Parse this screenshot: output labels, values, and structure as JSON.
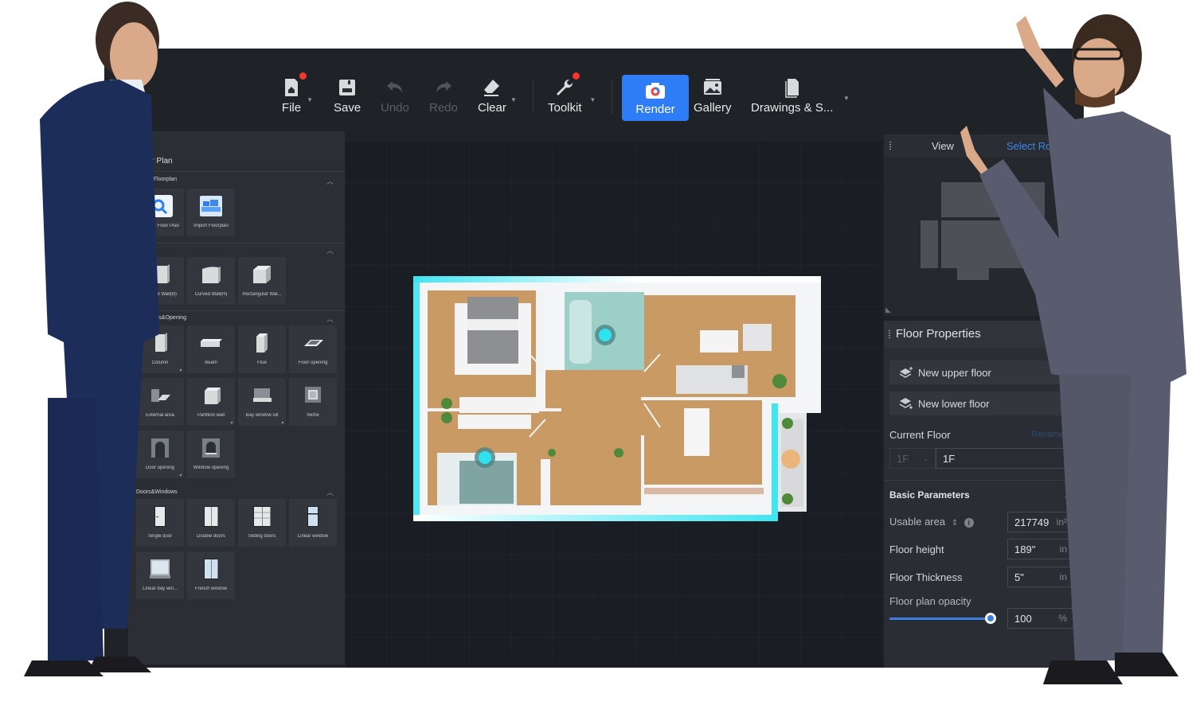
{
  "toolbar": {
    "items": [
      {
        "label": "File",
        "icon": "file-home-icon",
        "has_dropdown": true,
        "badge": true,
        "enabled": true
      },
      {
        "label": "Save",
        "icon": "save-icon",
        "has_dropdown": false,
        "badge": false,
        "enabled": true
      },
      {
        "label": "Undo",
        "icon": "undo-icon",
        "has_dropdown": false,
        "badge": false,
        "enabled": false
      },
      {
        "label": "Redo",
        "icon": "redo-icon",
        "has_dropdown": false,
        "badge": false,
        "enabled": false
      },
      {
        "label": "Clear",
        "icon": "eraser-icon",
        "has_dropdown": true,
        "badge": false,
        "enabled": true
      },
      {
        "label": "Toolkit",
        "icon": "wrench-icon",
        "has_dropdown": true,
        "badge": true,
        "enabled": true
      },
      {
        "label": "Render",
        "icon": "camera-icon",
        "active": true
      },
      {
        "label": "Gallery",
        "icon": "gallery-icon"
      },
      {
        "label": "Drawings & S...",
        "icon": "drawings-icon",
        "has_dropdown": true
      }
    ],
    "accent_color": "#2f7df6",
    "badge_color": "#f4362b"
  },
  "left_panel": {
    "title": "Floor Plan",
    "sections": [
      {
        "heading": "Import Floorplan",
        "items": [
          {
            "label": "Search Floor Plan",
            "icon": "search-floorplan-icon"
          },
          {
            "label": "Import Floorplan",
            "icon": "import-floorplan-icon"
          }
        ]
      },
      {
        "heading": "",
        "items": [
          {
            "label": "Straight Wall(B)",
            "icon": "straight-wall-icon"
          },
          {
            "label": "Curved Wall(H)",
            "icon": "curved-wall-icon"
          },
          {
            "label": "Rectangular Wal...",
            "icon": "rectangular-wall-icon"
          }
        ]
      },
      {
        "heading": "Structures&Opening",
        "items": [
          {
            "label": "Column",
            "icon": "column-icon"
          },
          {
            "label": "Beam",
            "icon": "beam-icon"
          },
          {
            "label": "Flue",
            "icon": "flue-icon"
          },
          {
            "label": "Floor opening",
            "icon": "floor-opening-icon"
          },
          {
            "label": "External area",
            "icon": "external-area-icon"
          },
          {
            "label": "Partition wall",
            "icon": "partition-wall-icon"
          },
          {
            "label": "Bay window sill",
            "icon": "bay-window-sill-icon"
          },
          {
            "label": "Niche",
            "icon": "niche-icon"
          },
          {
            "label": "Door opening",
            "icon": "door-opening-icon"
          },
          {
            "label": "Window opening",
            "icon": "window-opening-icon"
          }
        ]
      },
      {
        "heading": "Doors&Windows",
        "items": [
          {
            "label": "Single door",
            "icon": "single-door-icon"
          },
          {
            "label": "Double doors",
            "icon": "double-doors-icon"
          },
          {
            "label": "Sliding doors",
            "icon": "sliding-doors-icon"
          },
          {
            "label": "Linear window",
            "icon": "linear-window-icon"
          },
          {
            "label": "Linear bay win...",
            "icon": "linear-bay-window-icon"
          },
          {
            "label": "French window",
            "icon": "french-window-icon"
          }
        ]
      }
    ]
  },
  "view_panel": {
    "tabs": [
      {
        "label": "View",
        "active": false
      },
      {
        "label": "Select Room",
        "active": true
      }
    ],
    "active_color": "#3d86ea"
  },
  "floor_properties": {
    "title": "Floor Properties",
    "new_upper_floor": "New upper floor",
    "new_lower_floor": "New lower floor",
    "current_floor_label": "Current Floor",
    "current_floor_link": "Rename",
    "floor_select": "1F",
    "floor_name": "1F",
    "basic_parameters_label": "Basic Parameters",
    "usable_area": {
      "label": "Usable area",
      "value": "217749",
      "unit": "in²"
    },
    "floor_height": {
      "label": "Floor height",
      "value": "189\"",
      "unit": "in"
    },
    "floor_thickness": {
      "label": "Floor Thickness",
      "value": "5\"",
      "unit": "in"
    },
    "opacity": {
      "label": "Floor plan opacity",
      "value": "100",
      "unit": "%",
      "percent": 100
    }
  }
}
